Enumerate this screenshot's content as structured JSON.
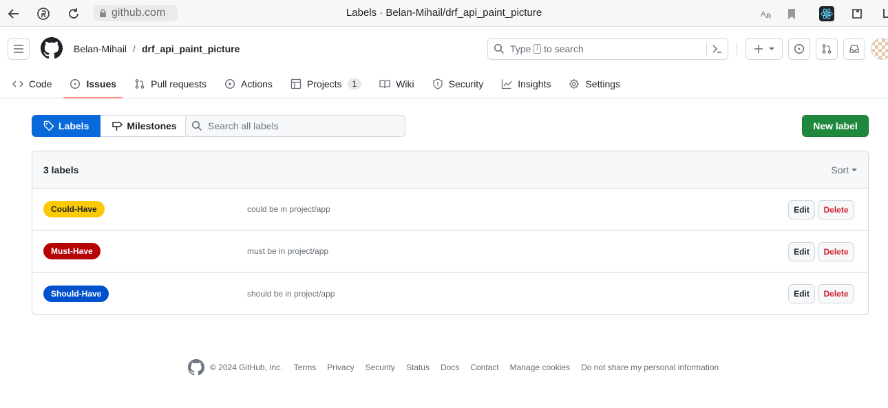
{
  "browser": {
    "url": "github.com",
    "title": "Labels · Belan-Mihail/drf_api_paint_picture"
  },
  "header": {
    "owner": "Belan-Mihail",
    "separator": "/",
    "repo": "drf_api_paint_picture",
    "search_placeholder_prefix": "Type",
    "search_slash": "/",
    "search_placeholder_suffix": "to search"
  },
  "tabs": [
    {
      "label": "Code",
      "icon": "code-icon"
    },
    {
      "label": "Issues",
      "icon": "issue-opened-icon",
      "selected": true
    },
    {
      "label": "Pull requests",
      "icon": "git-pull-request-icon"
    },
    {
      "label": "Actions",
      "icon": "play-icon"
    },
    {
      "label": "Projects",
      "icon": "table-icon",
      "count": "1"
    },
    {
      "label": "Wiki",
      "icon": "book-icon"
    },
    {
      "label": "Security",
      "icon": "shield-icon"
    },
    {
      "label": "Insights",
      "icon": "graph-icon"
    },
    {
      "label": "Settings",
      "icon": "gear-icon"
    }
  ],
  "subnav": {
    "labels": "Labels",
    "milestones": "Milestones",
    "search_placeholder": "Search all labels",
    "new_label": "New label"
  },
  "list": {
    "count_text": "3 labels",
    "sort": "Sort",
    "edit": "Edit",
    "delete": "Delete",
    "rows": [
      {
        "name": "Could-Have",
        "description": "could be in project/app",
        "bg": "#fbca04",
        "fg": "#1f2328"
      },
      {
        "name": "Must-Have",
        "description": "must be in project/app",
        "bg": "#b60205",
        "fg": "#ffffff"
      },
      {
        "name": "Should-Have",
        "description": "should be in project/app",
        "bg": "#0052cc",
        "fg": "#ffffff"
      }
    ]
  },
  "footer": {
    "copyright": "© 2024 GitHub, Inc.",
    "links": [
      "Terms",
      "Privacy",
      "Security",
      "Status",
      "Docs",
      "Contact",
      "Manage cookies",
      "Do not share my personal information"
    ]
  },
  "colors": {
    "accent": "#0969da",
    "primary_button": "#1f883d",
    "tab_underline": "#fd8c73",
    "danger": "#cf222e"
  }
}
